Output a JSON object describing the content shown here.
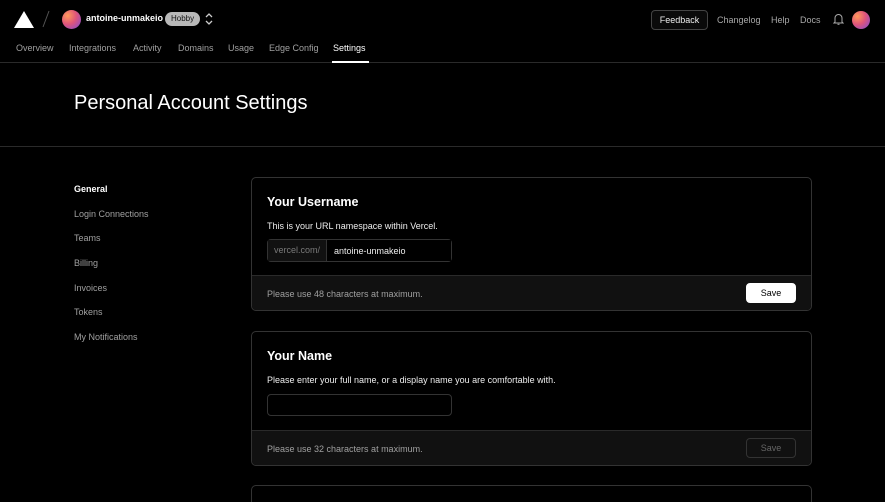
{
  "topbar": {
    "account_name": "antoine-unmakeio",
    "plan_badge": "Hobby",
    "feedback_label": "Feedback",
    "links": [
      "Changelog",
      "Help",
      "Docs"
    ]
  },
  "nav": {
    "tabs": [
      "Overview",
      "Integrations",
      "Activity",
      "Domains",
      "Usage",
      "Edge Config",
      "Settings"
    ],
    "active_tab": "Settings"
  },
  "header": {
    "title": "Personal Account Settings"
  },
  "sidebar": {
    "items": [
      "General",
      "Login Connections",
      "Teams",
      "Billing",
      "Invoices",
      "Tokens",
      "My Notifications"
    ],
    "active": "General"
  },
  "username_card": {
    "title": "Your Username",
    "description": "This is your URL namespace within Vercel.",
    "url_prefix": "vercel.com/",
    "value": "antoine-unmakeio",
    "footer_note": "Please use 48 characters at maximum.",
    "save_label": "Save"
  },
  "name_card": {
    "title": "Your Name",
    "description": "Please enter your full name, or a display name you are comfortable with.",
    "value": "",
    "footer_note": "Please use 32 characters at maximum.",
    "save_label": "Save"
  },
  "colors": {
    "background": "#000000",
    "border": "#333333",
    "accent": "#ffffff"
  }
}
